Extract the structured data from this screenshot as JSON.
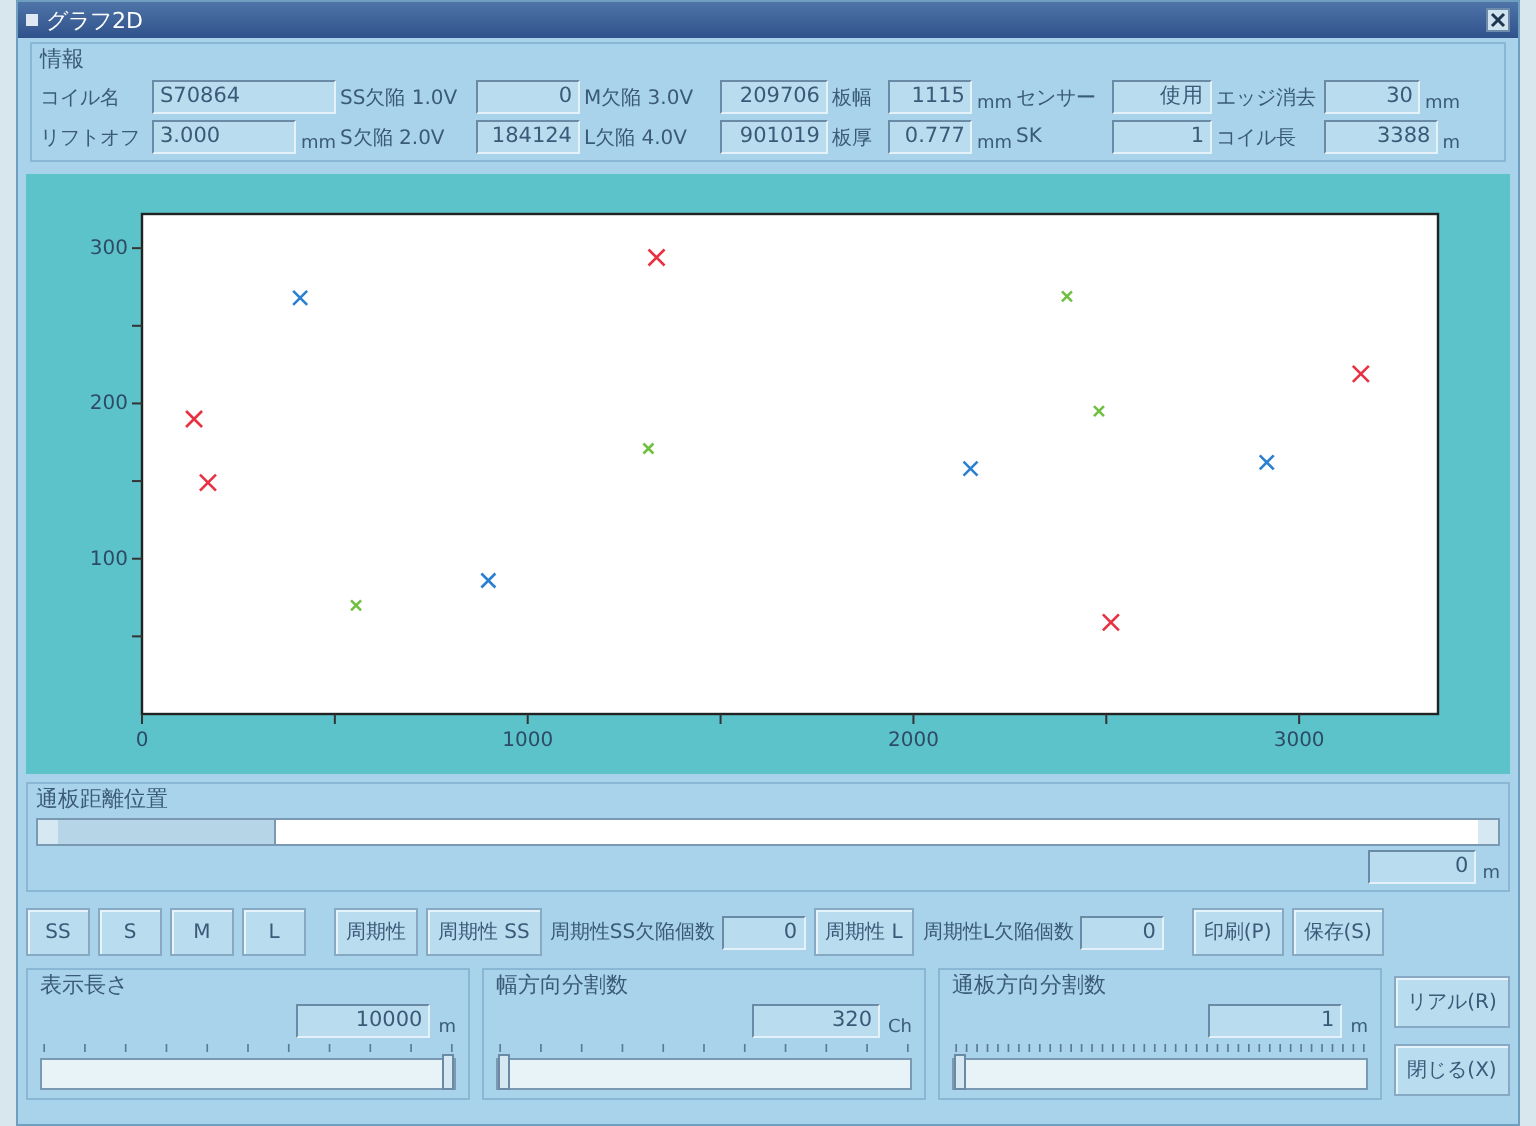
{
  "window": {
    "title": "グラフ2D"
  },
  "info": {
    "title": "情報",
    "rows": [
      [
        {
          "label": "コイル名",
          "value": "S70864"
        },
        {
          "label": "SS欠陥 1.0V",
          "value": "0"
        },
        {
          "label": "M欠陥 3.0V",
          "value": "209706"
        },
        {
          "label": "板幅",
          "value": "1115",
          "unit": "mm"
        },
        {
          "label": "センサー",
          "value": "使用"
        },
        {
          "label": "エッジ消去",
          "value": "30",
          "unit": "mm"
        }
      ],
      [
        {
          "label": "リフトオフ",
          "value": "3.000",
          "unit": "mm"
        },
        {
          "label": "S欠陥 2.0V",
          "value": "184124"
        },
        {
          "label": "L欠陥 4.0V",
          "value": "901019"
        },
        {
          "label": "板厚",
          "value": "0.777",
          "unit": "mm"
        },
        {
          "label": "SK",
          "value": "1"
        },
        {
          "label": "コイル長",
          "value": "3388",
          "unit": "m"
        }
      ]
    ]
  },
  "chart": {
    "chart_data": {
      "type": "scatter",
      "xlim": [
        0,
        3360
      ],
      "ylim": [
        0,
        322
      ],
      "xticks": [
        0,
        1000,
        2000,
        3000
      ],
      "yticks": [
        100,
        200,
        300
      ],
      "series": [
        {
          "color": "#e83040",
          "x": [
            135,
            171,
            1334,
            2512,
            3160
          ],
          "values": [
            190,
            149,
            294,
            59,
            219
          ]
        },
        {
          "color": "#2a7fd0",
          "x": [
            410,
            898,
            2148,
            2916
          ],
          "values": [
            268,
            86,
            158,
            162
          ]
        },
        {
          "color": "#70c040",
          "x": [
            555,
            1313,
            2398,
            2481
          ],
          "values": [
            70,
            171,
            269,
            195
          ]
        }
      ]
    }
  },
  "position": {
    "title": "通板距離位置",
    "value": "0",
    "unit": "m"
  },
  "toolbar": [
    {
      "kind": "button",
      "label": "SS"
    },
    {
      "kind": "button",
      "label": "S"
    },
    {
      "kind": "button",
      "label": "M"
    },
    {
      "kind": "button",
      "label": "L"
    },
    {
      "kind": "button",
      "label": "周期性"
    },
    {
      "kind": "button",
      "label": "周期性 SS"
    },
    {
      "kind": "count",
      "label": "周期性SS欠陥個数",
      "value": "0"
    },
    {
      "kind": "button",
      "label": "周期性 L"
    },
    {
      "kind": "count",
      "label": "周期性L欠陥個数",
      "value": "0"
    },
    {
      "kind": "button",
      "label": "印刷(P)"
    },
    {
      "kind": "button",
      "label": "保存(S)"
    }
  ],
  "sliders": [
    {
      "title": "表示長さ",
      "value": "10000",
      "unit": "m",
      "level": 1
    },
    {
      "title": "幅方向分割数",
      "value": "320",
      "unit": "Ch",
      "level": 0
    },
    {
      "title": "通板方向分割数",
      "value": "1",
      "unit": "m",
      "level": 0
    }
  ],
  "side_buttons": [
    "リアル(R)",
    "閉じる(X)"
  ]
}
